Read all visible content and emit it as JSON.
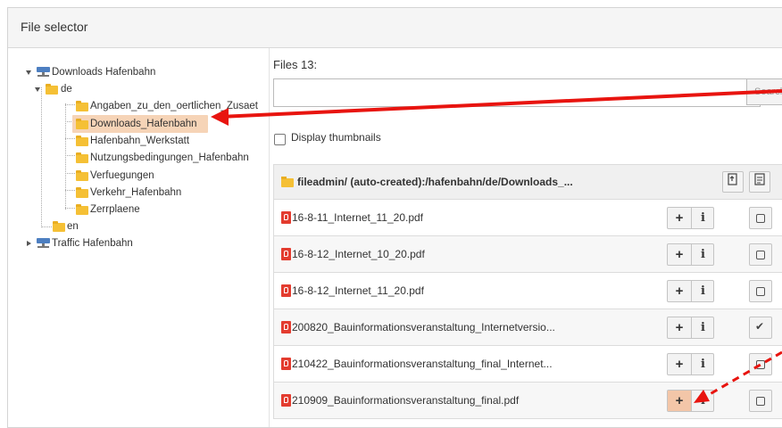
{
  "window": {
    "title": "File selector"
  },
  "tree": {
    "root1": "Downloads Hafenbahn",
    "de": "de",
    "children": [
      "Angaben_zu_den_oertlichen_Zusaet",
      "Downloads_Hafenbahn",
      "Hafenbahn_Werkstatt",
      "Nutzungsbedingungen_Hafenbahn",
      "Verfuegungen",
      "Verkehr_Hafenbahn",
      "Zerrplaene"
    ],
    "en": "en",
    "root2": "Traffic Hafenbahn",
    "selected": "Downloads_Hafenbahn"
  },
  "files": {
    "count_label": "Files 13:",
    "search_placeholder": "",
    "search_button": "Search",
    "thumbnails_label": "Display thumbnails",
    "path": "fileadmin/ (auto-created):/hafenbahn/de/Downloads_...",
    "rows": [
      {
        "name": "16-8-11_Internet_11_20.pdf",
        "selected": false
      },
      {
        "name": "16-8-12_Internet_10_20.pdf",
        "selected": false
      },
      {
        "name": "16-8-12_Internet_11_20.pdf",
        "selected": false
      },
      {
        "name": "200820_Bauinformationsveranstaltung_Internetversio...",
        "selected": true
      },
      {
        "name": "210422_Bauinformationsveranstaltung_final_Internet...",
        "selected": false
      },
      {
        "name": "210909_Bauinformationsveranstaltung_final.pdf",
        "selected": false
      }
    ],
    "add_symbol": "+",
    "info_symbol": "i"
  },
  "colors": {
    "highlight": "#f6d4b7",
    "arrow": "#e8140f",
    "add_active": "#f3c6a8",
    "pdf": "#e33c2f"
  },
  "icons": [
    "server-icon",
    "folder-icon",
    "pdf-icon",
    "upload-icon",
    "select-all-icon",
    "checkbox-icon",
    "checkmark-icon"
  ]
}
